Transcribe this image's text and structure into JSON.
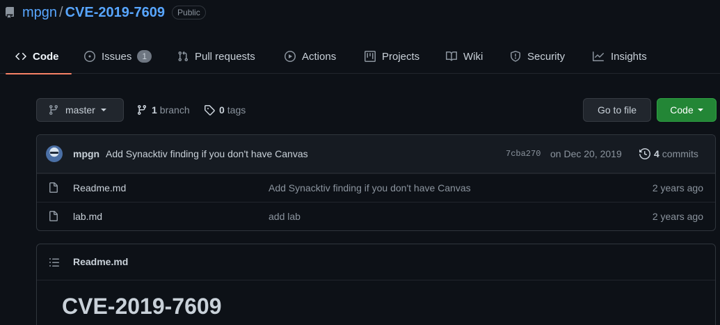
{
  "repo": {
    "owner": "mpgn",
    "separator": "/",
    "name": "CVE-2019-7609",
    "visibility": "Public"
  },
  "tabs": [
    {
      "label": "Code",
      "icon": "code-icon",
      "active": true
    },
    {
      "label": "Issues",
      "icon": "issue-opened-icon",
      "count": "1"
    },
    {
      "label": "Pull requests",
      "icon": "git-pull-request-icon"
    },
    {
      "label": "Actions",
      "icon": "play-icon"
    },
    {
      "label": "Projects",
      "icon": "table-icon"
    },
    {
      "label": "Wiki",
      "icon": "book-icon"
    },
    {
      "label": "Security",
      "icon": "shield-icon"
    },
    {
      "label": "Insights",
      "icon": "graph-icon"
    }
  ],
  "toolbar": {
    "branch": "master",
    "branch_count": "1",
    "branch_label": "branch",
    "tag_count": "0",
    "tag_label": "tags",
    "goto_label": "Go to file",
    "code_label": "Code"
  },
  "commit": {
    "author": "mpgn",
    "message": "Add Synacktiv finding if you don't have Canvas",
    "sha": "7cba270",
    "date": "on Dec 20, 2019",
    "count": "4",
    "count_label": "commits"
  },
  "files": [
    {
      "name": "Readme.md",
      "message": "Add Synacktiv finding if you don't have Canvas",
      "age": "2 years ago"
    },
    {
      "name": "lab.md",
      "message": "add lab",
      "age": "2 years ago"
    }
  ],
  "readme": {
    "title": "Readme.md",
    "heading": "CVE-2019-7609"
  },
  "colors": {
    "background": "#0d1117",
    "link": "#58a6ff",
    "active_tab_underline": "#f78166",
    "primary_button": "#238636"
  }
}
